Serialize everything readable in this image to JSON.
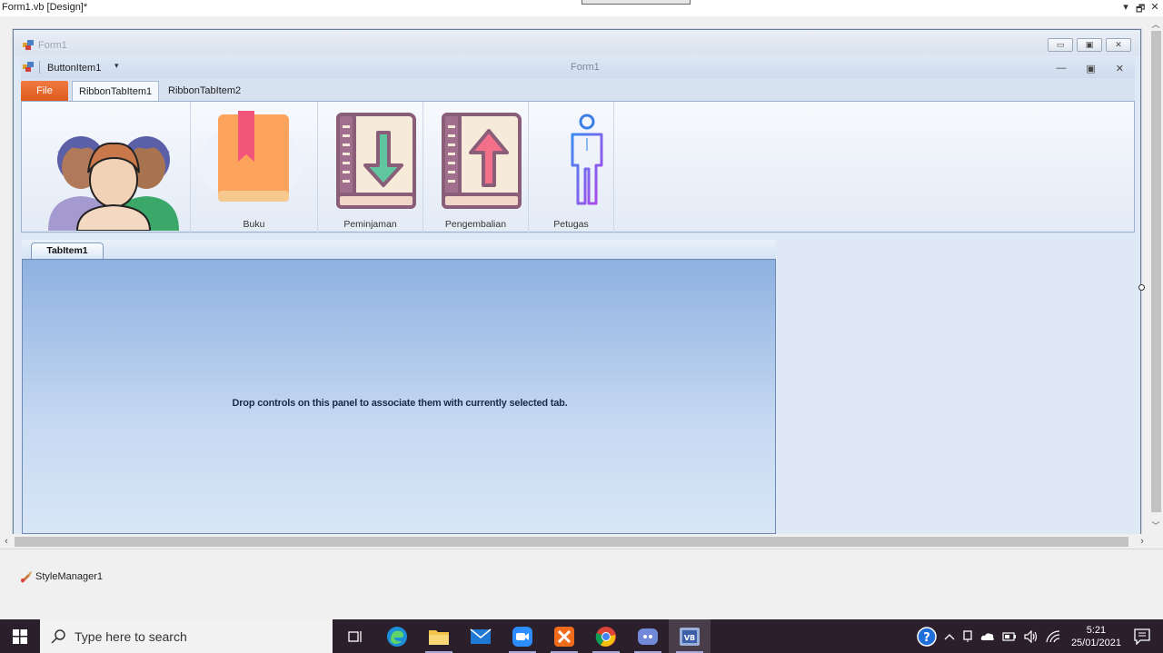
{
  "doc_tab": {
    "title": "Form1.vb [Design]*",
    "controls": [
      "▾",
      "🗗",
      "✕"
    ]
  },
  "form": {
    "title": "Form1",
    "buttons": [
      "▭",
      "▣",
      "✕"
    ]
  },
  "ribbon": {
    "qat_item": "ButtonItem1",
    "qat_dropdown": "▾",
    "window_title": "Form1",
    "window_controls": [
      "—",
      "▣",
      "✕"
    ],
    "file_tab": "File",
    "tabs": [
      "RibbonTabItem1",
      "RibbonTabItem2"
    ],
    "buttons": [
      {
        "label": "",
        "icon": "users-icon"
      },
      {
        "label": "Buku",
        "icon": "book-icon"
      },
      {
        "label": "Peminjaman",
        "icon": "book-download-icon"
      },
      {
        "label": "Pengembalian",
        "icon": "book-upload-icon"
      },
      {
        "label": "Petugas",
        "icon": "person-icon"
      }
    ]
  },
  "tab_control": {
    "tab": "TabItem1",
    "message": "Drop controls on this panel to associate them with currently selected tab."
  },
  "component_tray": {
    "item": "StyleManager1"
  },
  "taskbar": {
    "search_placeholder": "Type here to search",
    "time": "5:21",
    "date": "25/01/2021",
    "colors": {
      "background": "#2b1f2b",
      "search_bg": "#f2f2f2"
    }
  }
}
